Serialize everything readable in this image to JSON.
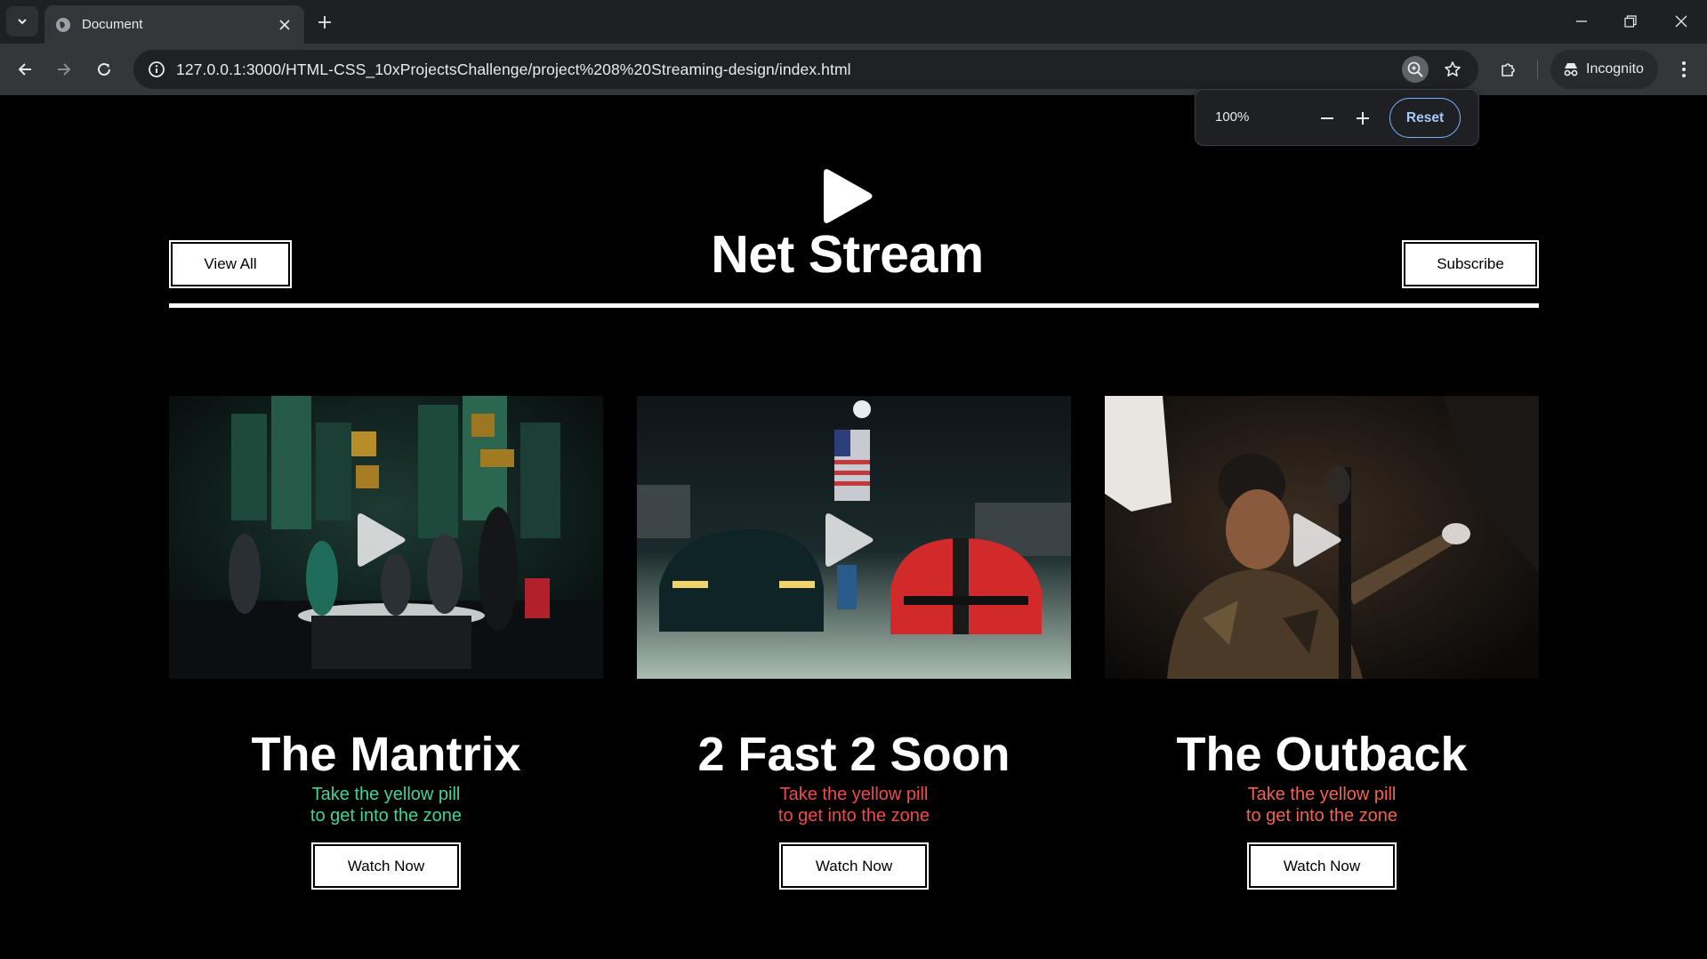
{
  "browser": {
    "tab_title": "Document",
    "url": "127.0.0.1:3000/HTML-CSS_10xProjectsChallenge/project%208%20Streaming-design/index.html",
    "incognito_label": "Incognito",
    "zoom_popup": {
      "level": "100%",
      "reset_label": "Reset"
    }
  },
  "header": {
    "title": "Net Stream",
    "view_all_label": "View All",
    "subscribe_label": "Subscribe"
  },
  "cards": [
    {
      "title": "The Mantrix",
      "subtitle_line1": "Take the yellow pill",
      "subtitle_line2": "to get into the zone",
      "subtitle_color": "#3ed597",
      "button_label": "Watch Now"
    },
    {
      "title": "2 Fast 2 Soon",
      "subtitle_line1": "Take the yellow pill",
      "subtitle_line2": "to get into the zone",
      "subtitle_color": "#ef4a4a",
      "button_label": "Watch Now"
    },
    {
      "title": "The Outback",
      "subtitle_line1": "Take the yellow pill",
      "subtitle_line2": "to get into the zone",
      "subtitle_color": "#f0624d",
      "button_label": "Watch Now"
    }
  ]
}
